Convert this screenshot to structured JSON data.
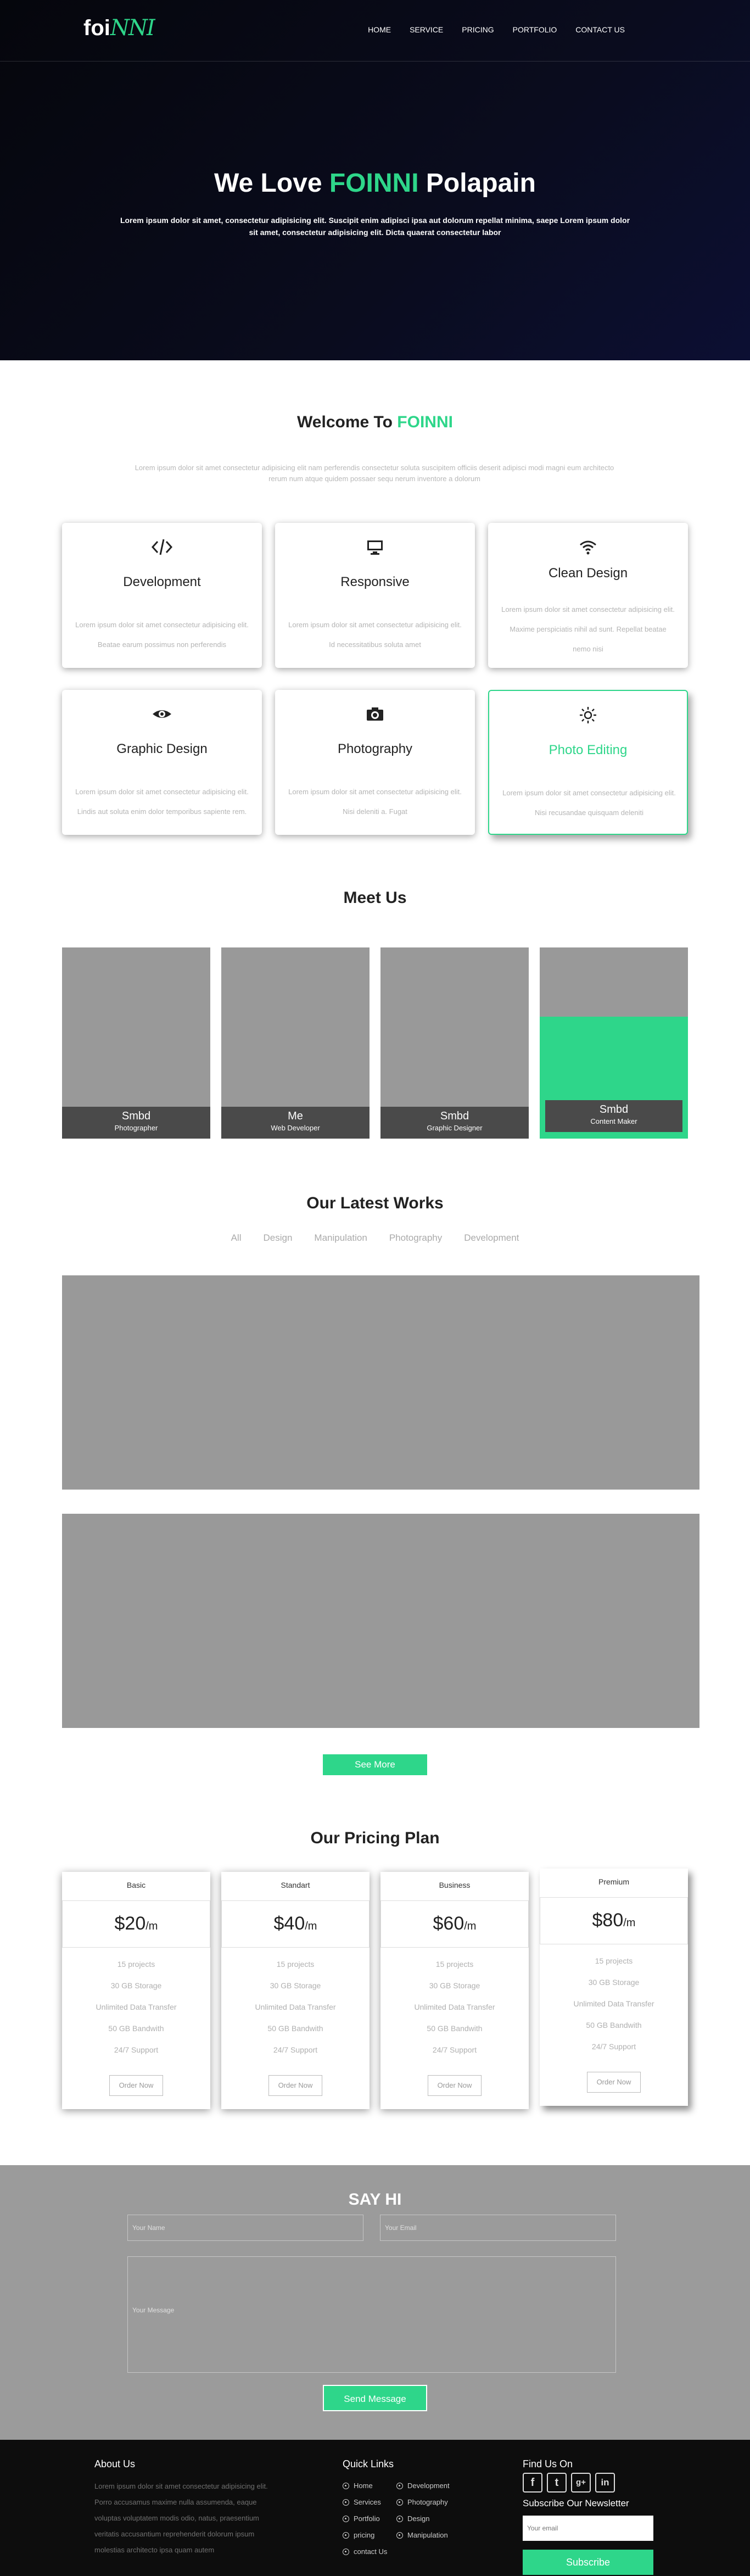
{
  "nav": {
    "logo_main": "foi",
    "logo_script": "NNI",
    "items": [
      "HOME",
      "SERVICE",
      "PRICING",
      "PORTFOLIO",
      "CONTACT US"
    ]
  },
  "hero": {
    "title_pre": "We Love",
    "title_brand": "FOINNI",
    "title_post": "Polapain",
    "subtitle": "Lorem ipsum dolor sit amet, consectetur adipisicing elit. Suscipit enim adipisci ipsa aut dolorum repellat minima, saepe Lorem ipsum dolor sit amet, consectetur adipisicing elit. Dicta quaerat consectetur labor"
  },
  "welcome": {
    "title_pre": "Welcome To",
    "title_brand": "FOINNI",
    "text": "Lorem ipsum dolor sit amet consectetur adipisicing elit nam perferendis consectetur soluta suscipitem officiis deserit adipisci modi magni eum architecto rerum num atque quidem possaer sequ nerum inventore a dolorum"
  },
  "services": [
    {
      "icon": "code-icon",
      "title": "Development",
      "text": "Lorem ipsum dolor sit amet consectetur adipisicing elit. Beatae earum possimus non perferendis"
    },
    {
      "icon": "monitor-icon",
      "title": "Responsive",
      "text": "Lorem ipsum dolor sit amet consectetur adipisicing elit. Id necessitatibus soluta amet"
    },
    {
      "icon": "wifi-icon",
      "title": "Clean Design",
      "text": "Lorem ipsum dolor sit amet consectetur adipisicing elit. Maxime perspiciatis nihil ad sunt. Repellat beatae nemo nisi"
    },
    {
      "icon": "eye-icon",
      "title": "Graphic Design",
      "text": "Lorem ipsum dolor sit amet consectetur adipisicing elit. Lindis aut soluta enim dolor temporibus sapiente rem. Ise"
    },
    {
      "icon": "camera-icon",
      "title": "Photography",
      "text": "Lorem ipsum dolor sit amet consectetur adipisicing elit. Nisi deleniti a. Fugat"
    },
    {
      "icon": "sun-icon",
      "title": "Photo Editing",
      "text": "Lorem ipsum dolor sit amet consectetur adipisicing elit. Nisi recusandae quisquam deleniti"
    }
  ],
  "team": {
    "title": "Meet Us",
    "members": [
      {
        "name": "Smbd",
        "role": "Photographer"
      },
      {
        "name": "Me",
        "role": "Web Developer"
      },
      {
        "name": "Smbd",
        "role": "Graphic Designer"
      },
      {
        "name": "Smbd",
        "role": "Content Maker"
      }
    ]
  },
  "works": {
    "title": "Our Latest Works",
    "filters": [
      "All",
      "Design",
      "Manipulation",
      "Photography",
      "Development"
    ],
    "see_more": "See More"
  },
  "pricing": {
    "title": "Our Pricing Plan",
    "unit": "/m",
    "order_label": "Order Now",
    "plans": [
      {
        "name": "Basic",
        "price": "$20"
      },
      {
        "name": "Standart",
        "price": "$40"
      },
      {
        "name": "Business",
        "price": "$60"
      },
      {
        "name": "Premium",
        "price": "$80"
      }
    ],
    "features": [
      "15 projects",
      "30 GB Storage",
      "Unlimited Data Transfer",
      "50 GB Bandwith",
      "24/7 Support"
    ]
  },
  "contact": {
    "title": "SAY HI",
    "name_placeholder": "Your Name",
    "email_placeholder": "Your Email",
    "message_placeholder": "Your Message",
    "send_label": "Send Message"
  },
  "footer": {
    "about_title": "About Us",
    "about_text": "Lorem ipsum dolor sit amet consectetur adipisicing elit. Porro accusamus maxime nulla assumenda, eaque voluptas voluptatem modis odio, natus, praesentium veritatis accusantium reprehenderit dolorum ipsum molestias architecto ipsa quam autem",
    "links_title": "Quick Links",
    "links_col1": [
      "Home",
      "Services",
      "Portfolio",
      "pricing",
      "contact Us"
    ],
    "links_col2": [
      "Development",
      "Photography",
      "Design",
      "Manipulation"
    ],
    "find_title": "Find Us On",
    "social": [
      "f",
      "t",
      "g+",
      "in"
    ],
    "subscribe_title": "Subscribe Our Newsletter",
    "email_placeholder": "Your email",
    "subscribe_label": "Subscribe"
  }
}
